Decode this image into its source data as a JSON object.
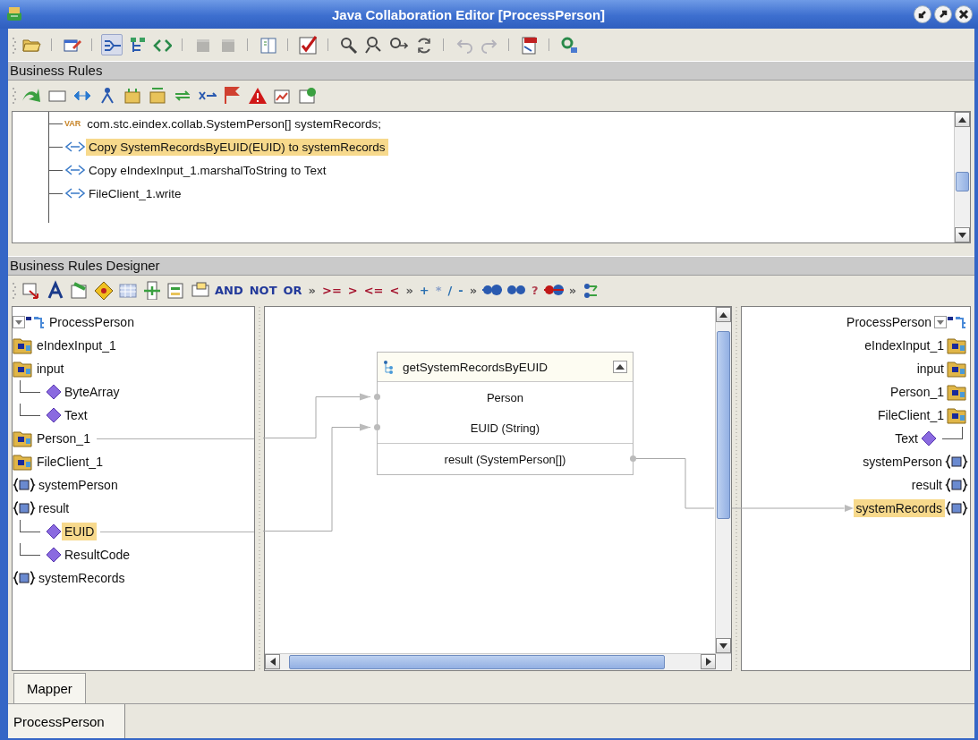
{
  "window": {
    "title": "Java Collaboration Editor [ProcessPerson]"
  },
  "main_toolbar": [
    {
      "kind": "grip"
    },
    {
      "kind": "icon"
    },
    {
      "kind": "separator"
    },
    {
      "kind": "icon"
    },
    {
      "kind": "separator"
    },
    {
      "kind": "icon",
      "pressed": true
    },
    {
      "kind": "icon",
      "pressed": false
    },
    {
      "kind": "icon",
      "pressed": false
    },
    {
      "kind": "separator"
    },
    {
      "kind": "icon",
      "disabled": true
    },
    {
      "kind": "icon",
      "disabled": true
    },
    {
      "kind": "separator"
    },
    {
      "kind": "icon"
    },
    {
      "kind": "separator"
    },
    {
      "kind": "icon"
    },
    {
      "kind": "separator"
    },
    {
      "kind": "icon"
    },
    {
      "kind": "icon"
    },
    {
      "kind": "icon"
    },
    {
      "kind": "icon"
    },
    {
      "kind": "separator"
    },
    {
      "kind": "icon",
      "disabled": true
    },
    {
      "kind": "icon",
      "disabled": true
    },
    {
      "kind": "separator"
    },
    {
      "kind": "icon"
    },
    {
      "kind": "separator"
    },
    {
      "kind": "icon"
    }
  ],
  "business_rules": {
    "title": "Business Rules",
    "toolbar": [
      {
        "kind": "grip"
      },
      {
        "kind": "icon"
      },
      {
        "kind": "icon"
      },
      {
        "kind": "icon"
      },
      {
        "kind": "icon"
      },
      {
        "kind": "icon"
      },
      {
        "kind": "icon"
      },
      {
        "kind": "icon"
      },
      {
        "kind": "icon"
      },
      {
        "kind": "icon"
      },
      {
        "kind": "icon"
      },
      {
        "kind": "icon"
      },
      {
        "kind": "icon"
      }
    ],
    "rules": [
      {
        "kind": "declaration",
        "badge": "VAR",
        "text": "com.stc.eindex.collab.SystemPerson[] systemRecords;",
        "selected": false
      },
      {
        "kind": "statement",
        "text": "Copy SystemRecordsByEUID(EUID) to systemRecords",
        "selected": true
      },
      {
        "kind": "statement",
        "text": "Copy eIndexInput_1.marshalToString to Text",
        "selected": false
      },
      {
        "kind": "statement",
        "text": "FileClient_1.write",
        "selected": false
      }
    ]
  },
  "designer": {
    "title": "Business Rules Designer",
    "toolbar": [
      {
        "kind": "grip"
      },
      {
        "kind": "icon"
      },
      {
        "kind": "icon"
      },
      {
        "kind": "icon"
      },
      {
        "kind": "icon"
      },
      {
        "kind": "icon"
      },
      {
        "kind": "icon"
      },
      {
        "kind": "icon"
      },
      {
        "kind": "icon"
      },
      {
        "kind": "text",
        "label": "AND",
        "color": "#22399a"
      },
      {
        "kind": "text",
        "label": "NOT",
        "color": "#22399a"
      },
      {
        "kind": "text",
        "label": "OR",
        "color": "#22399a"
      },
      {
        "kind": "text",
        "label": "»",
        "color": "#555555"
      },
      {
        "kind": "text",
        "label": ">=",
        "color": "#a5152f"
      },
      {
        "kind": "text",
        "label": ">",
        "color": "#a5152f"
      },
      {
        "kind": "text",
        "label": "<=",
        "color": "#a5152f"
      },
      {
        "kind": "text",
        "label": "<",
        "color": "#a5152f"
      },
      {
        "kind": "text",
        "label": "»",
        "color": "#555555"
      },
      {
        "kind": "text",
        "label": "+",
        "color": "#2a6fb0"
      },
      {
        "kind": "text",
        "label": "*",
        "color": "#8aa0c8"
      },
      {
        "kind": "text",
        "label": "/",
        "color": "#2a6fb0"
      },
      {
        "kind": "text",
        "label": "-",
        "color": "#2a6fb0"
      },
      {
        "kind": "text",
        "label": "»",
        "color": "#555555"
      },
      {
        "kind": "icon"
      },
      {
        "kind": "icon"
      },
      {
        "kind": "text",
        "label": "?",
        "color": "#b04050"
      },
      {
        "kind": "icon"
      },
      {
        "kind": "text",
        "label": "»",
        "color": "#555555"
      },
      {
        "kind": "icon"
      }
    ],
    "source_tree": {
      "label": "ProcessPerson",
      "expanded": true,
      "children": [
        {
          "kind": "object",
          "label": "eIndexInput_1",
          "selected": false,
          "linked": false
        },
        {
          "kind": "object",
          "label": "input",
          "selected": false,
          "linked": false,
          "children": [
            {
              "kind": "field",
              "label": "ByteArray",
              "selected": false,
              "linked": false
            },
            {
              "kind": "field",
              "label": "Text",
              "selected": false,
              "linked": false
            }
          ]
        },
        {
          "kind": "object",
          "label": "Person_1",
          "selected": false,
          "linked": true
        },
        {
          "kind": "object",
          "label": "FileClient_1",
          "selected": false,
          "linked": false
        },
        {
          "kind": "variable",
          "label": "systemPerson",
          "selected": false,
          "linked": false
        },
        {
          "kind": "variable",
          "label": "result",
          "selected": false,
          "linked": false,
          "children": [
            {
              "kind": "field",
              "label": "EUID",
              "selected": true,
              "linked": true
            },
            {
              "kind": "field",
              "label": "ResultCode",
              "selected": false,
              "linked": false
            }
          ]
        },
        {
          "kind": "variable",
          "label": "systemRecords",
          "selected": false,
          "linked": false
        }
      ]
    },
    "method": {
      "title": "getSystemRecordsByEUID",
      "expanded": true,
      "inputs": [
        {
          "label": "Person",
          "linked": true
        },
        {
          "label": "EUID (String)",
          "linked": true
        }
      ],
      "outputs": [
        {
          "label": "result (SystemPerson[])",
          "linked": true
        }
      ]
    },
    "target_tree": {
      "label": "ProcessPerson",
      "expanded": true,
      "children": [
        {
          "kind": "object",
          "label": "eIndexInput_1",
          "selected": false,
          "linked": false
        },
        {
          "kind": "object",
          "label": "input",
          "selected": false,
          "linked": false
        },
        {
          "kind": "object",
          "label": "Person_1",
          "selected": false,
          "linked": false
        },
        {
          "kind": "object",
          "label": "FileClient_1",
          "selected": false,
          "linked": false
        },
        {
          "kind": "field",
          "label": "Text",
          "selected": false,
          "linked": false
        },
        {
          "kind": "variable",
          "label": "systemPerson",
          "selected": false,
          "linked": false
        },
        {
          "kind": "variable",
          "label": "result",
          "selected": false,
          "linked": false
        },
        {
          "kind": "variable",
          "label": "systemRecords",
          "selected": true,
          "linked": true
        }
      ]
    }
  },
  "view_tabs": [
    {
      "label": "Mapper",
      "selected": true
    }
  ],
  "document_tabs": [
    {
      "label": "ProcessPerson",
      "selected": true
    }
  ]
}
